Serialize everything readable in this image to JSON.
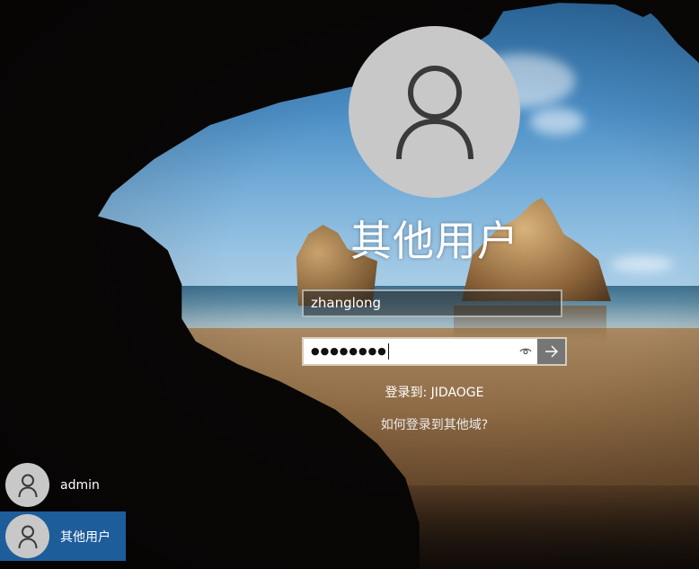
{
  "login": {
    "avatar_icon": "user-icon",
    "title": "其他用户",
    "username_value": "zhanglong",
    "password_mask": "●●●●●●●●",
    "reveal_icon": "eye-icon",
    "submit_icon": "arrow-right-icon",
    "signin_to": "登录到: JIDAOGE",
    "other_domain_link": "如何登录到其他域?"
  },
  "user_list": [
    {
      "name": "admin",
      "icon": "user-icon",
      "selected": false
    },
    {
      "name": "其他用户",
      "icon": "user-icon",
      "selected": true
    }
  ],
  "colors": {
    "selected_user_bg": "#1d5d9a",
    "avatar_bg": "#c8c8c8",
    "submit_bg": "#767676"
  }
}
